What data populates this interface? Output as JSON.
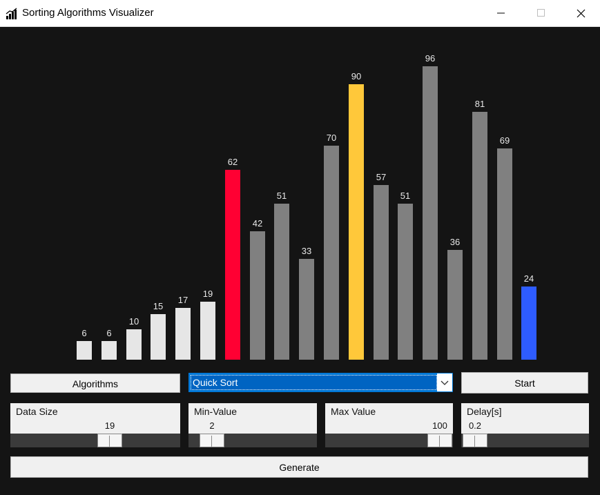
{
  "window": {
    "title": "Sorting Algorithms Visualizer",
    "icon": "bar-chart-icon",
    "controls": [
      "minimize-icon",
      "maximize-icon",
      "close-icon"
    ]
  },
  "colors": {
    "background": "#141414",
    "sorted": "#e6e6e6",
    "unsorted": "#808080",
    "pivot": "#ff0033",
    "compare": "#ffc83a",
    "current": "#2e5cff"
  },
  "bars": [
    {
      "value": 6,
      "state": "sorted"
    },
    {
      "value": 6,
      "state": "sorted"
    },
    {
      "value": 10,
      "state": "sorted"
    },
    {
      "value": 15,
      "state": "sorted"
    },
    {
      "value": 17,
      "state": "sorted"
    },
    {
      "value": 19,
      "state": "sorted"
    },
    {
      "value": 62,
      "state": "pivot"
    },
    {
      "value": 42,
      "state": "unsorted"
    },
    {
      "value": 51,
      "state": "unsorted"
    },
    {
      "value": 33,
      "state": "unsorted"
    },
    {
      "value": 70,
      "state": "unsorted"
    },
    {
      "value": 90,
      "state": "compare"
    },
    {
      "value": 57,
      "state": "unsorted"
    },
    {
      "value": 51,
      "state": "unsorted"
    },
    {
      "value": 96,
      "state": "unsorted"
    },
    {
      "value": 36,
      "state": "unsorted"
    },
    {
      "value": 81,
      "state": "unsorted"
    },
    {
      "value": 69,
      "state": "unsorted"
    },
    {
      "value": 24,
      "state": "current"
    }
  ],
  "controls": {
    "algorithms_label": "Algorithms",
    "algorithm_selected": "Quick Sort",
    "start_label": "Start",
    "generate_label": "Generate"
  },
  "sliders": {
    "data_size": {
      "label": "Data Size",
      "value": "19",
      "fraction": 0.58
    },
    "min_value": {
      "label": "Min-Value",
      "value": "2",
      "fraction": 0.1
    },
    "max_value": {
      "label": "Max Value",
      "value": "100",
      "fraction": 0.92
    },
    "delay": {
      "label": "Delay[s]",
      "value": "0.2",
      "fraction": 0.08
    }
  }
}
